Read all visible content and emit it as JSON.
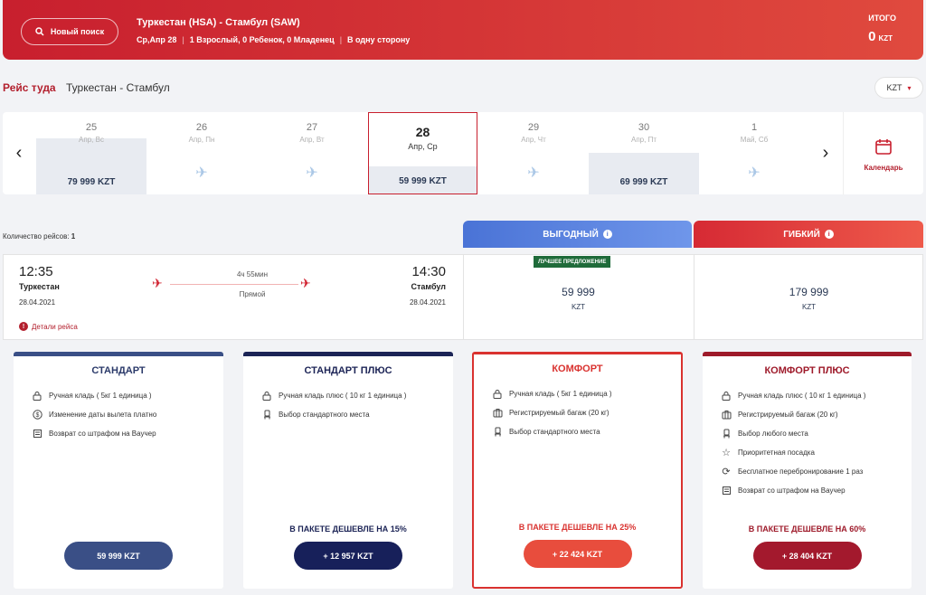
{
  "header": {
    "search_label": "Новый поиск",
    "route_title": "Туркестан (HSA) - Стамбул (SAW)",
    "date": "Ср,Апр 28",
    "passengers": "1 Взрослый, 0 Ребенок, 0 Младенец",
    "trip_type": "В одну сторону",
    "separator": "|",
    "total_label": "ИТОГО",
    "total_value": "0",
    "total_currency": "KZT"
  },
  "direction": {
    "label": "Рейс туда",
    "route": "Туркестан - Стамбул",
    "currency": "KZT"
  },
  "dates": [
    {
      "day": "25",
      "sub": "Апр, Вс",
      "price": "79 999 KZT"
    },
    {
      "day": "26",
      "sub": "Апр, Пн",
      "price": ""
    },
    {
      "day": "27",
      "sub": "Апр, Вт",
      "price": ""
    },
    {
      "day": "28",
      "sub": "Апр, Ср",
      "price": "59 999 KZT"
    },
    {
      "day": "29",
      "sub": "Апр, Чт",
      "price": ""
    },
    {
      "day": "30",
      "sub": "Апр, Пт",
      "price": "69 999 KZT"
    },
    {
      "day": "1",
      "sub": "Май, Сб",
      "price": ""
    }
  ],
  "calendar_label": "Календарь",
  "flights_count_label": "Количество рейсов:",
  "flights_count": "1",
  "fares": {
    "economy_label": "ВЫГОДНЫЙ",
    "flex_label": "ГИБКИЙ",
    "best_offer": "ЛУЧШЕЕ ПРЕДЛОЖЕНИЕ"
  },
  "flight": {
    "dep_time": "12:35",
    "dep_city": "Туркестан",
    "dep_date": "28.04.2021",
    "duration": "4ч 55мин",
    "stops": "Прямой",
    "arr_time": "14:30",
    "arr_city": "Стамбул",
    "arr_date": "28.04.2021",
    "details": "Детали рейса",
    "economy_price": "59 999",
    "economy_currency": "KZT",
    "flex_price": "179 999",
    "flex_currency": "KZT"
  },
  "packages": [
    {
      "title": "СТАНДАРТ",
      "features": [
        "Ручная кладь ( 5кг 1 единица )",
        "Изменение даты вылета платно",
        "Возврат со штрафом на Ваучер"
      ],
      "promo": "",
      "button": "59 999 KZT"
    },
    {
      "title": "СТАНДАРТ ПЛЮС",
      "features": [
        "Ручная кладь плюс ( 10 кг 1 единица )",
        "Выбор стандартного места"
      ],
      "promo": "В ПАКЕТЕ ДЕШЕВЛЕ НА 15%",
      "button": "+ 12 957 KZT"
    },
    {
      "title": "КОМФОРТ",
      "features": [
        "Ручная кладь ( 5кг 1 единица )",
        "Регистрируемый багаж (20 кг)",
        "Выбор стандартного места"
      ],
      "promo": "В ПАКЕТЕ ДЕШЕВЛЕ НА 25%",
      "button": "+ 22 424 KZT"
    },
    {
      "title": "КОМФОРТ ПЛЮС",
      "features": [
        "Ручная кладь плюс ( 10 кг 1 единица )",
        "Регистрируемый багаж (20 кг)",
        "Выбор любого места",
        "Приоритетная посадка",
        "Бесплатное перебронирование 1 раз",
        "Возврат со штрафом на Ваучер"
      ],
      "promo": "В ПАКЕТЕ ДЕШЕВЛЕ НА 60%",
      "button": "+ 28 404 KZT"
    }
  ]
}
